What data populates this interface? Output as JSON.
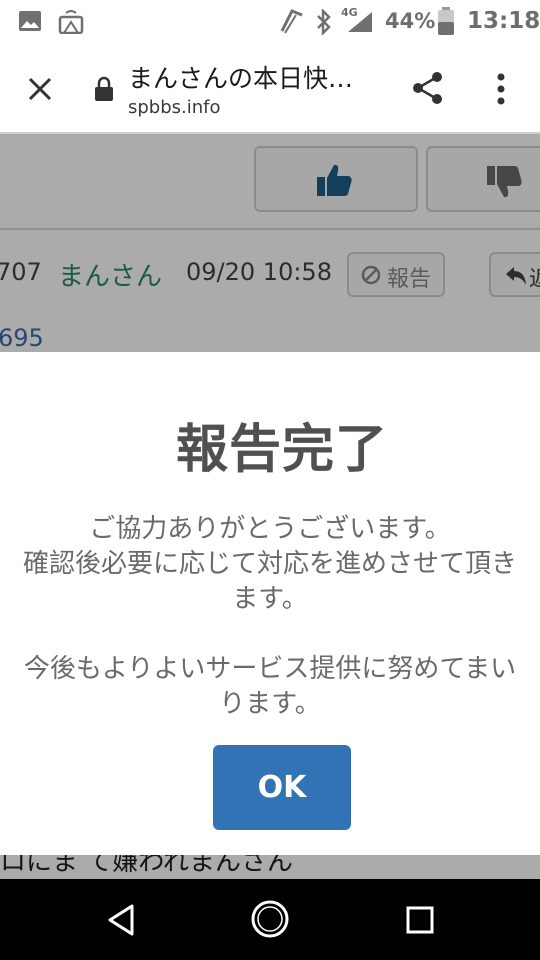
{
  "status_bar": {
    "network": "4G",
    "battery": "44%",
    "time": "13:18"
  },
  "browser": {
    "title": "まんさんの本日快…",
    "url": "spbbs.info"
  },
  "post": {
    "number": "707",
    "user": "まんさん",
    "datetime": "09/20 10:58",
    "report_label": "報告",
    "reply_partial": "返",
    "anchor": "695",
    "bottom_text": "ロにま て嫌われまんさん"
  },
  "dialog": {
    "title": "報告完了",
    "line1": "ご協力ありがとうございます。",
    "line2": "確認後必要に応じて対応を進めさせて頂き",
    "line3": "ます。",
    "line4": "今後もよりよいサービス提供に努めてまい",
    "line5": "ります。",
    "ok_label": "OK"
  },
  "colors": {
    "accent": "#3273b5",
    "username": "#2a8a6a",
    "link": "#3b6ea8"
  }
}
